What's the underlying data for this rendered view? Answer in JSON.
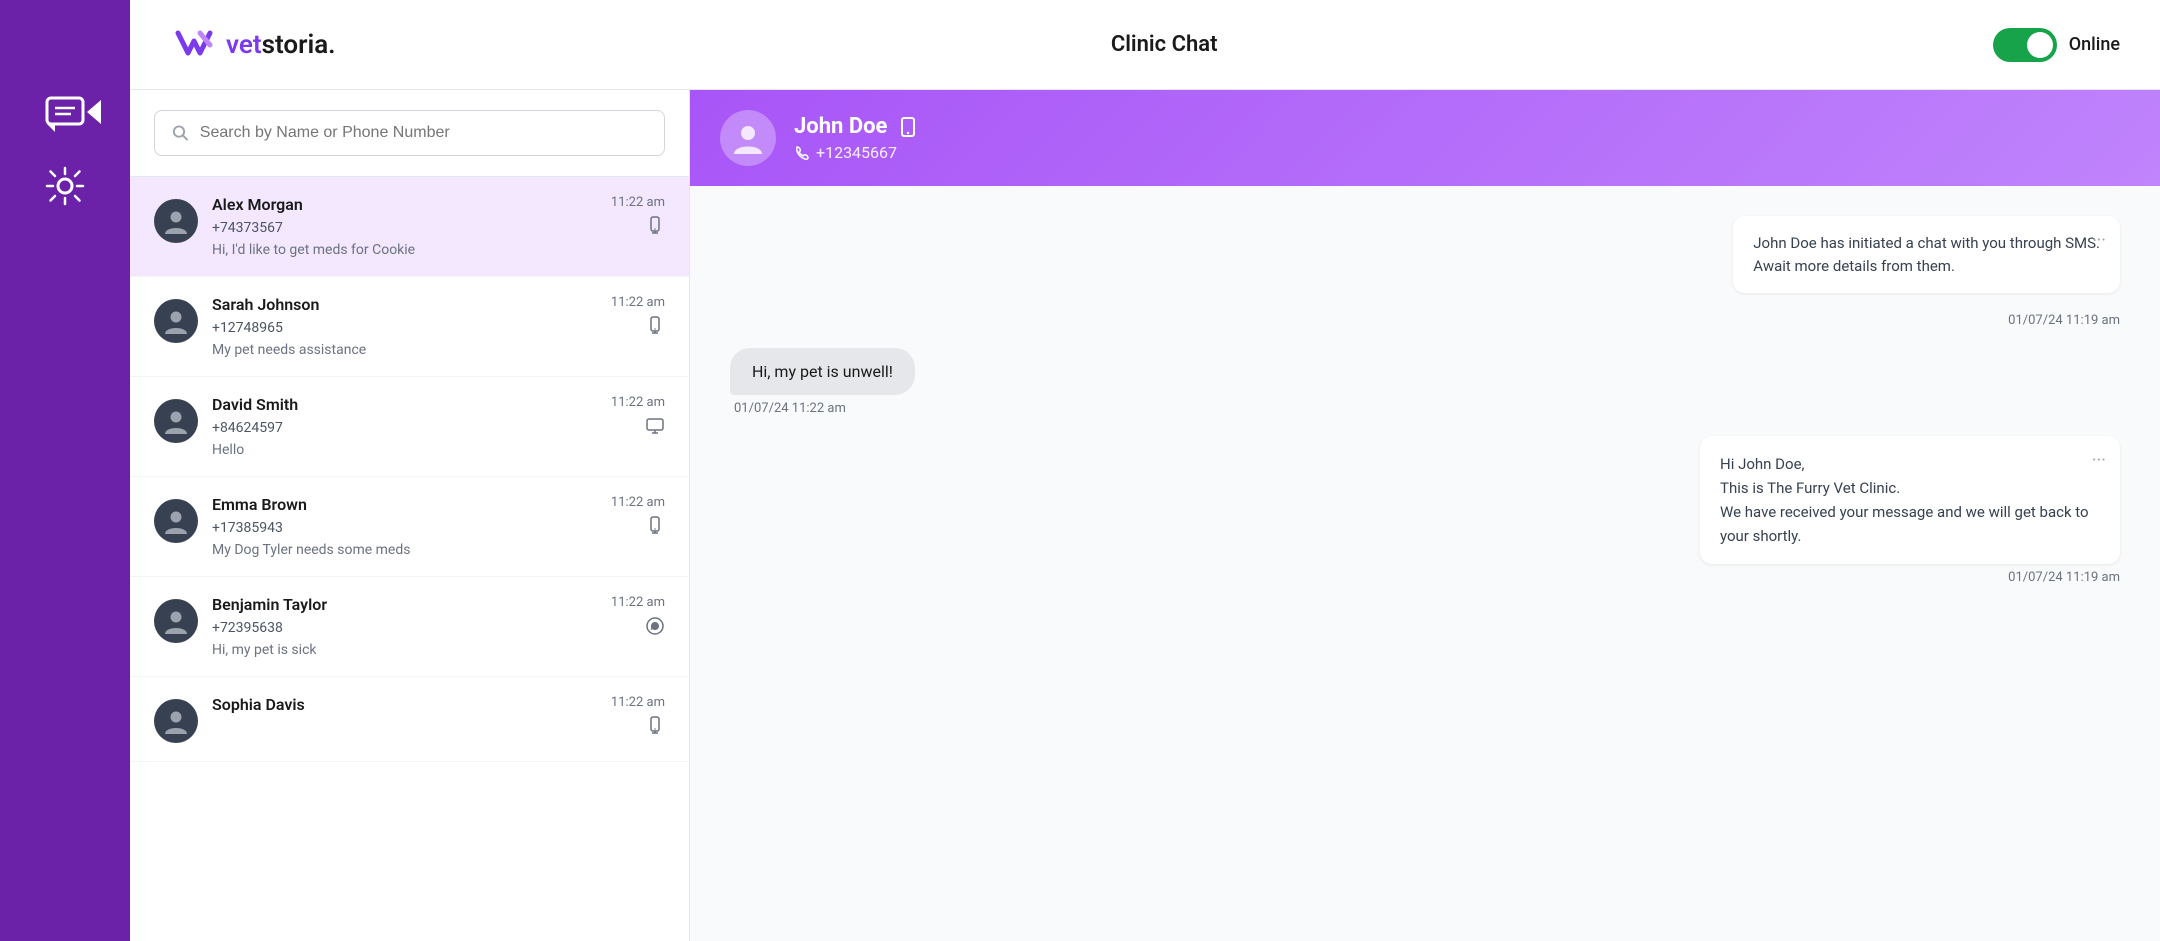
{
  "app": {
    "title": "Clinic Chat",
    "online_label": "Online"
  },
  "logo": {
    "text_vet": "vet",
    "text_storia": "storia."
  },
  "search": {
    "placeholder": "Search by Name or Phone Number"
  },
  "chat_list": [
    {
      "id": "alex-morgan",
      "name": "Alex Morgan",
      "phone": "+74373567",
      "time": "11:22 am",
      "preview": "Hi, I'd like to get meds for Cookie",
      "channel": "phone",
      "active": true
    },
    {
      "id": "sarah-johnson",
      "name": "Sarah Johnson",
      "phone": "+12748965",
      "time": "11:22 am",
      "preview": "My pet needs assistance",
      "channel": "phone",
      "active": false
    },
    {
      "id": "david-smith",
      "name": "David Smith",
      "phone": "+84624597",
      "time": "11:22 am",
      "preview": "Hello",
      "channel": "desktop",
      "active": false
    },
    {
      "id": "emma-brown",
      "name": "Emma Brown",
      "phone": "+17385943",
      "time": "11:22 am",
      "preview": "My Dog Tyler needs some meds",
      "channel": "phone",
      "active": false
    },
    {
      "id": "benjamin-taylor",
      "name": "Benjamin Taylor",
      "phone": "+72395638",
      "time": "11:22 am",
      "preview": "Hi, my pet is sick",
      "channel": "whatsapp",
      "active": false
    },
    {
      "id": "sophia-davis",
      "name": "Sophia Davis",
      "phone": "",
      "time": "11:22 am",
      "preview": "",
      "channel": "phone",
      "active": false
    }
  ],
  "active_chat": {
    "name": "John Doe",
    "phone": "+12345667",
    "messages": [
      {
        "type": "system",
        "text": "John Doe has initiated a chat with you through SMS.\nAwait more details from them.",
        "timestamp": ""
      },
      {
        "type": "incoming",
        "text": "Hi, my pet is unwell!",
        "timestamp": "01/07/24 11:22 am"
      },
      {
        "type": "outgoing",
        "text": "Hi John Doe,\nThis is The Furry Vet Clinic.\nWe have received your message and we will get back to your shortly.",
        "timestamp": "01/07/24 11:19 am"
      }
    ],
    "system_timestamp": "01/07/24 11:19 am",
    "outgoing_timestamp": "01/07/24 11:19 am"
  }
}
